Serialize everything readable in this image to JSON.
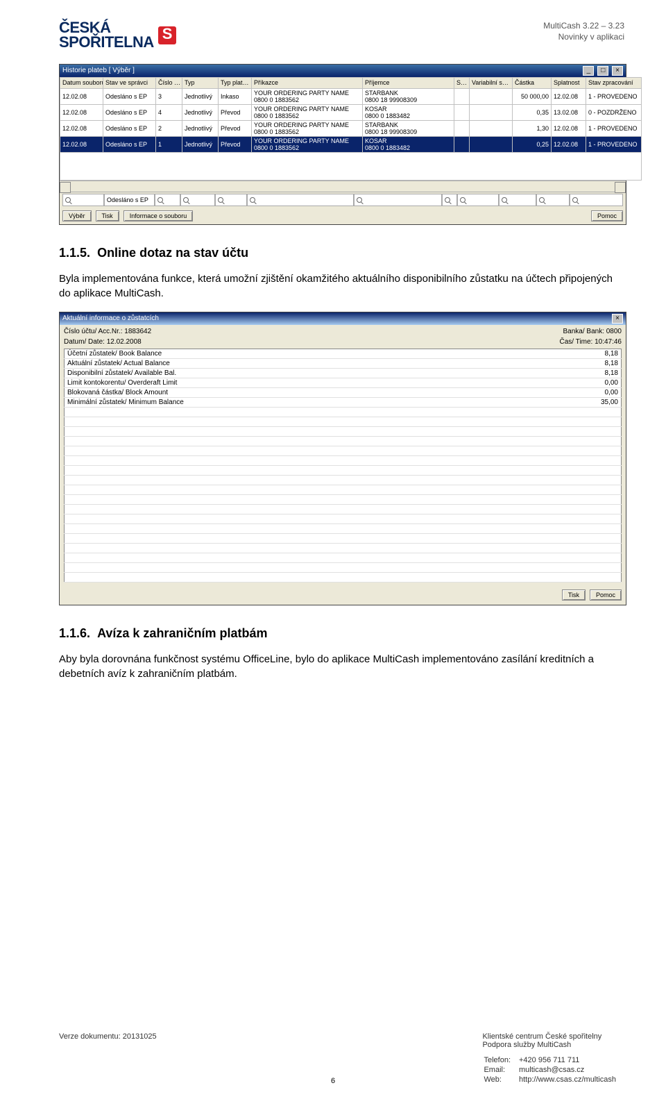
{
  "header": {
    "logo1": "ČESKÁ",
    "logo2": "SPOŘITELNA",
    "title_r1": "MultiCash 3.22 – 3.23",
    "title_r2": "Novinky v aplikaci"
  },
  "shot1": {
    "title": "Historie plateb  [ Výběr ]",
    "cols": [
      "Datum souboru",
      "Stav ve správci",
      "Číslo …",
      "Typ",
      "Typ plat…",
      "Příkazce",
      "Příjemce",
      "S…",
      "Variabilní s…",
      "Částka",
      "Splatnost",
      "Stav zpracování"
    ],
    "rows": [
      {
        "d": "12.02.08",
        "s": "Odesláno s EP",
        "c": "3",
        "t": "Jednotlivý",
        "tp": "Inkaso",
        "pk": "YOUR ORDERING PARTY NAME\n0800      0   1883562",
        "pj": "STARBANK\n0800     18  99908309",
        "vs": "",
        "am": "50 000,00",
        "sp": "12.02.08",
        "st": "1 - PROVEDENO"
      },
      {
        "d": "12.02.08",
        "s": "Odesláno s EP",
        "c": "4",
        "t": "Jednotlivý",
        "tp": "Převod",
        "pk": "YOUR ORDERING PARTY NAME\n0800      0   1883562",
        "pj": "KOSAR\n0800      0   1883482",
        "vs": "",
        "am": "0,35",
        "sp": "13.02.08",
        "st": "0 - POZDRŽENO"
      },
      {
        "d": "12.02.08",
        "s": "Odesláno s EP",
        "c": "2",
        "t": "Jednotlivý",
        "tp": "Převod",
        "pk": "YOUR ORDERING PARTY NAME\n0800      0   1883562",
        "pj": "STARBANK\n0800     18  99908309",
        "vs": "",
        "am": "1,30",
        "sp": "12.02.08",
        "st": "1 - PROVEDENO"
      },
      {
        "d": "12.02.08",
        "s": "Odesláno s EP",
        "c": "1",
        "t": "Jednotlivý",
        "tp": "Převod",
        "pk": "YOUR ORDERING PARTY NAME\n0800      0   1883562",
        "pj": "KOSAR\n0800      0   1883482",
        "vs": "",
        "am": "0,25",
        "sp": "12.02.08",
        "st": "1 - PROVEDENO"
      }
    ],
    "filter_text": "Odesláno s EP",
    "btn_vyber": "Výběr",
    "btn_tisk": "Tisk",
    "btn_info": "Informace o souboru",
    "btn_pomoc": "Pomoc"
  },
  "sec115": {
    "num": "1.1.5.",
    "title": "Online dotaz na stav účtu",
    "body": "Byla implementována funkce, která umožní zjištění okamžitého aktuálního disponibilního zůstatku na účtech připojených do aplikace MultiCash."
  },
  "shot2": {
    "title": "Aktuální informace o zůstatcích",
    "l1a": "Číslo účtu/ Acc.Nr.: 1883642",
    "l1b": "Banka/ Bank: 0800",
    "l2a": "Datum/ Date: 12.02.2008",
    "l2b": "Čas/ Time: 10:47:46",
    "rows": [
      {
        "k": "Účetní zůstatek/ Book Balance",
        "v": "8,18"
      },
      {
        "k": "Aktuální zůstatek/ Actual Balance",
        "v": "8,18"
      },
      {
        "k": "Disponibilní zůstatek/ Available Bal.",
        "v": "8,18"
      },
      {
        "k": "Limit kontokorentu/ Overderaft Limit",
        "v": "0,00"
      },
      {
        "k": "Blokovaná částka/ Block Amount",
        "v": "0,00"
      },
      {
        "k": "Minimální zůstatek/ Minimum Balance",
        "v": "35,00"
      }
    ],
    "btn_tisk": "Tisk",
    "btn_pomoc": "Pomoc"
  },
  "sec116": {
    "num": "1.1.6.",
    "title": "Avíza k zahraničním platbám",
    "body": "Aby byla dorovnána funkčnost systému OfficeLine, bylo do aplikace MultiCash implementováno zasílání kreditních a debetních avíz k zahraničním platbám."
  },
  "footer": {
    "verze": "Verze dokumentu: 20131025",
    "page": "6",
    "r1": "Klientské centrum České spořitelny",
    "r2": "Podpora služby MultiCash",
    "tel_l": "Telefon:",
    "tel_v": "+420 956 711 711",
    "em_l": "Email:",
    "em_v": "multicash@csas.cz",
    "web_l": "Web:",
    "web_v": "http://www.csas.cz/multicash"
  }
}
